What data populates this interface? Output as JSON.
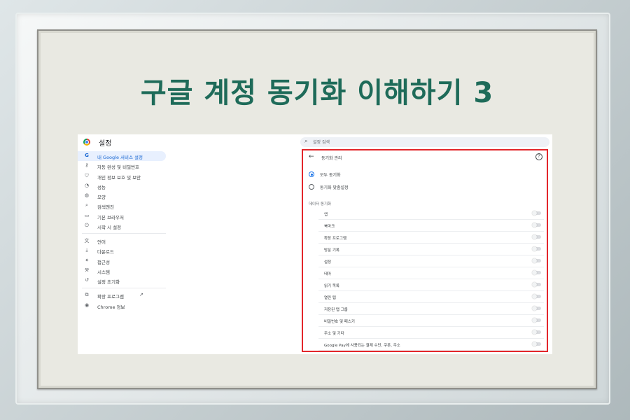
{
  "title": "구글 계정 동기화 이해하기 3",
  "colors": {
    "title": "#1e6b59",
    "highlight_border": "#e3262b",
    "accent": "#1a73e8"
  },
  "settings": {
    "app_title": "설정",
    "search_placeholder": "설정 검색",
    "sidebar": {
      "items": [
        {
          "icon": "G",
          "label": "내 Google 서비스 설정"
        },
        {
          "icon": "⚷",
          "label": "자동 완성 및 비밀번호"
        },
        {
          "icon": "⛉",
          "label": "개인 정보 보호 및 보안"
        },
        {
          "icon": "◔",
          "label": "성능"
        },
        {
          "icon": "◍",
          "label": "모양"
        },
        {
          "icon": "⌕",
          "label": "검색엔진"
        },
        {
          "icon": "▭",
          "label": "기본 브라우저"
        },
        {
          "icon": "⏻",
          "label": "시작 시 설정"
        }
      ],
      "items2": [
        {
          "icon": "文",
          "label": "언어"
        },
        {
          "icon": "⤓",
          "label": "다운로드"
        },
        {
          "icon": "✦",
          "label": "접근성"
        },
        {
          "icon": "⚒",
          "label": "시스템"
        },
        {
          "icon": "↺",
          "label": "설정 초기화"
        }
      ],
      "items3": [
        {
          "icon": "⧉",
          "label": "확장 프로그램",
          "ext_icon": "↗"
        },
        {
          "icon": "◉",
          "label": "Chrome 정보"
        }
      ]
    },
    "panel": {
      "title": "동기화 관리",
      "help_icon": "?",
      "back_icon": "←",
      "radio_all": "모두 동기화",
      "radio_custom": "동기화 맞춤설정",
      "section_label": "데이터 동기화",
      "sync_items": [
        "앱",
        "북마크",
        "확장 프로그램",
        "방문 기록",
        "설정",
        "테마",
        "읽기 목록",
        "열린 탭",
        "저장된 탭 그룹",
        "비밀번호 및 패스키",
        "주소 및 기타",
        "Google Pay에 사용되는 결제 수단, 쿠폰, 주소"
      ]
    }
  }
}
